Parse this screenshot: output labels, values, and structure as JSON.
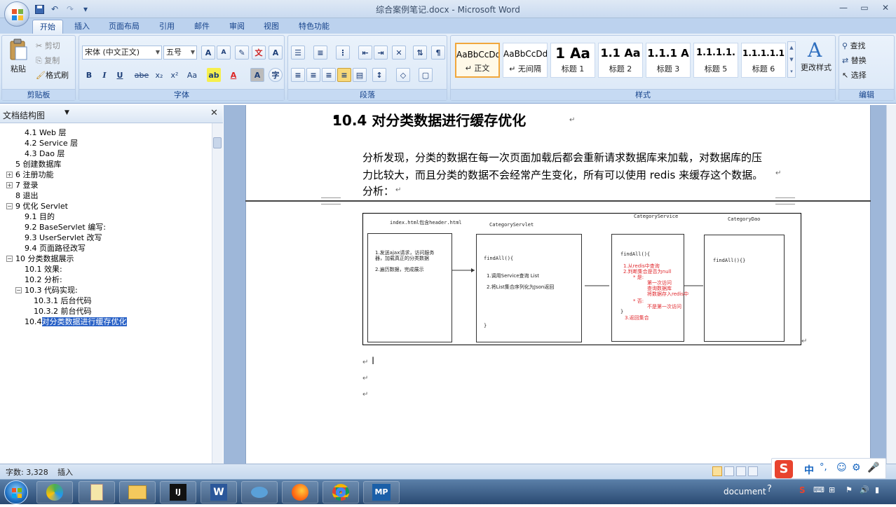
{
  "window": {
    "title": "综合案例笔记.docx - Microsoft Word",
    "controls": [
      "minimize",
      "maximize",
      "close"
    ]
  },
  "quick_access": [
    "save-icon",
    "undo-icon",
    "redo-icon",
    "customize-icon"
  ],
  "ribbon_tabs": [
    "开始",
    "插入",
    "页面布局",
    "引用",
    "邮件",
    "审阅",
    "视图",
    "特色功能"
  ],
  "active_tab": "开始",
  "ribbon": {
    "clipboard": {
      "label": "剪贴板",
      "paste": "粘贴",
      "cut": "剪切",
      "copy": "复制",
      "format_painter": "格式刷"
    },
    "font": {
      "label": "字体",
      "font_name": "宋体 (中文正文)",
      "font_size": "五号",
      "bold": "B",
      "italic": "I",
      "underline": "U",
      "strike": "abe",
      "subscript": "x₂",
      "superscript": "x²",
      "change_case": "Aa",
      "grow": "A",
      "shrink": "A",
      "font_color": "A",
      "clear": "A"
    },
    "paragraph": {
      "label": "段落"
    },
    "styles": {
      "label": "样式",
      "items": [
        {
          "sample": "AaBbCcDd",
          "name": "↵ 正文"
        },
        {
          "sample": "AaBbCcDd",
          "name": "↵ 无间隔"
        },
        {
          "sample": "1  Aa",
          "name": "标题 1"
        },
        {
          "sample": "1.1  Aa",
          "name": "标题 2"
        },
        {
          "sample": "1.1.1  A",
          "name": "标题 3"
        },
        {
          "sample": "1.1.1.1.",
          "name": "标题 5"
        },
        {
          "sample": "1.1.1.1.1",
          "name": "标题 6"
        }
      ],
      "change_styles": "更改样式"
    },
    "editing": {
      "label": "编辑",
      "find": "查找",
      "replace": "替换",
      "select": "选择"
    }
  },
  "nav_pane": {
    "title": "文档结构图",
    "items": [
      {
        "text": "4.1 Web 层",
        "level": 2
      },
      {
        "text": "4.2 Service 层",
        "level": 2
      },
      {
        "text": "4.3 Dao 层",
        "level": 2
      },
      {
        "text": "5 创建数据库",
        "level": 1
      },
      {
        "text": "6 注册功能",
        "level": 1,
        "expander": "+"
      },
      {
        "text": "7 登录",
        "level": 1,
        "expander": "+"
      },
      {
        "text": "8 退出",
        "level": 1
      },
      {
        "text": "9 优化 Servlet",
        "level": 1,
        "expander": "−"
      },
      {
        "text": "9.1 目的",
        "level": 2
      },
      {
        "text": "9.2 BaseServlet 编写:",
        "level": 2
      },
      {
        "text": "9.3 UserServlet 改写",
        "level": 2
      },
      {
        "text": "9.4 页面路径改写",
        "level": 2
      },
      {
        "text": "10 分类数据展示",
        "level": 1,
        "expander": "−"
      },
      {
        "text": "10.1 效果:",
        "level": 2
      },
      {
        "text": "10.2   分析:",
        "level": 2
      },
      {
        "text": "10.3 代码实现:",
        "level": 2,
        "expander": "−"
      },
      {
        "text": "10.3.1 后台代码",
        "level": 3
      },
      {
        "text": "10.3.2 前台代码",
        "level": 3
      },
      {
        "text": "10.4",
        "level": 2,
        "selected_text": "对分类数据进行缓存优化"
      }
    ]
  },
  "document": {
    "heading": "10.4   对分类数据进行缓存优化",
    "para_line1": "分析发现，分类的数据在每一次页面加载后都会重新请求数据库来加载，对数据库的压",
    "para_line2": "力比较大，而且分类的数据不会经常产生变化，所有可以使用 redis 来缓存这个数据。",
    "para_line3": "分析：",
    "diagram": {
      "box1_title": "index.html包含header.html",
      "box1_lines": [
        "1.发送ajax请求，访问服务",
        "器，加载真正的分类数据",
        "2.遍历数据，完成展示"
      ],
      "box2_title": "CategoryServlet",
      "box2_lines": [
        "findAll(){",
        "1.调用Service查询  List",
        "2.将List集合序列化为Json返回",
        "}"
      ],
      "box3_title": "CategoryService",
      "box3_head": "findAll(){",
      "box3_red": [
        "1.从redis中查询",
        "2.判断集合是否为null",
        "* 是:",
        "第一次访问",
        "查询数据库",
        "将数据存入redis中",
        "* 否:",
        "不是第一次访问",
        "3.返回集合"
      ],
      "box3_close": "}",
      "box4_title": "CategoryDao",
      "box4_lines": [
        "findAll(){}"
      ]
    }
  },
  "status": {
    "word_count": "字数: 3,328",
    "mode": "插入"
  },
  "ime": {
    "label": "中"
  },
  "taskbar": {
    "apps": [
      "start-orb",
      "app-360",
      "app-notepad",
      "app-explorer",
      "app-intellij",
      "app-word",
      "app-dolphin",
      "app-firefox",
      "app-chrome",
      "app-mp"
    ],
    "tray_text": "document"
  }
}
